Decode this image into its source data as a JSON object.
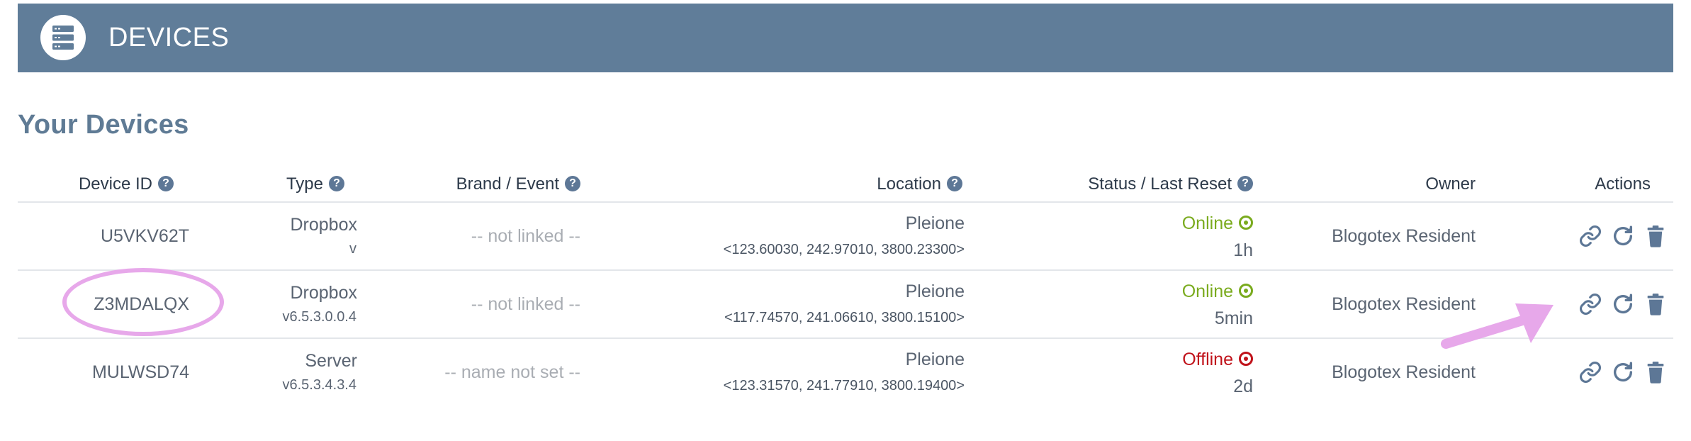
{
  "header": {
    "title": "DEVICES",
    "icon": "server-icon",
    "color": "#607d99"
  },
  "section": {
    "title": "Your Devices"
  },
  "table": {
    "columns": {
      "device_id": "Device ID",
      "type": "Type",
      "brand": "Brand / Event",
      "location": "Location",
      "status": "Status / Last Reset",
      "owner": "Owner",
      "actions": "Actions"
    },
    "help_glyph": "?",
    "rows": [
      {
        "device_id": "U5VKV62T",
        "type": "Dropbox",
        "version": "v",
        "brand": "-- not linked --",
        "location": "Pleione",
        "coords": "<123.60030, 242.97010, 3800.23300>",
        "status": "Online",
        "last_reset": "1h",
        "owner": "Blogotex Resident"
      },
      {
        "device_id": "Z3MDALQX",
        "type": "Dropbox",
        "version": "v6.5.3.0.0.4",
        "brand": "-- not linked --",
        "location": "Pleione",
        "coords": "<117.74570, 241.06610, 3800.15100>",
        "status": "Online",
        "last_reset": "5min",
        "owner": "Blogotex Resident"
      },
      {
        "device_id": "MULWSD74",
        "type": "Server",
        "version": "v6.5.3.4.3.4",
        "brand": "-- name not set --",
        "location": "Pleione",
        "coords": "<123.31570, 241.77910, 3800.19400>",
        "status": "Offline",
        "last_reset": "2d",
        "owner": "Blogotex Resident"
      }
    ],
    "actions": [
      "link-icon",
      "refresh-icon",
      "trash-icon"
    ]
  },
  "colors": {
    "online": "#7aab1e",
    "offline": "#c0121a",
    "annotation": "#e7a8ea",
    "icon": "#5d7796"
  }
}
